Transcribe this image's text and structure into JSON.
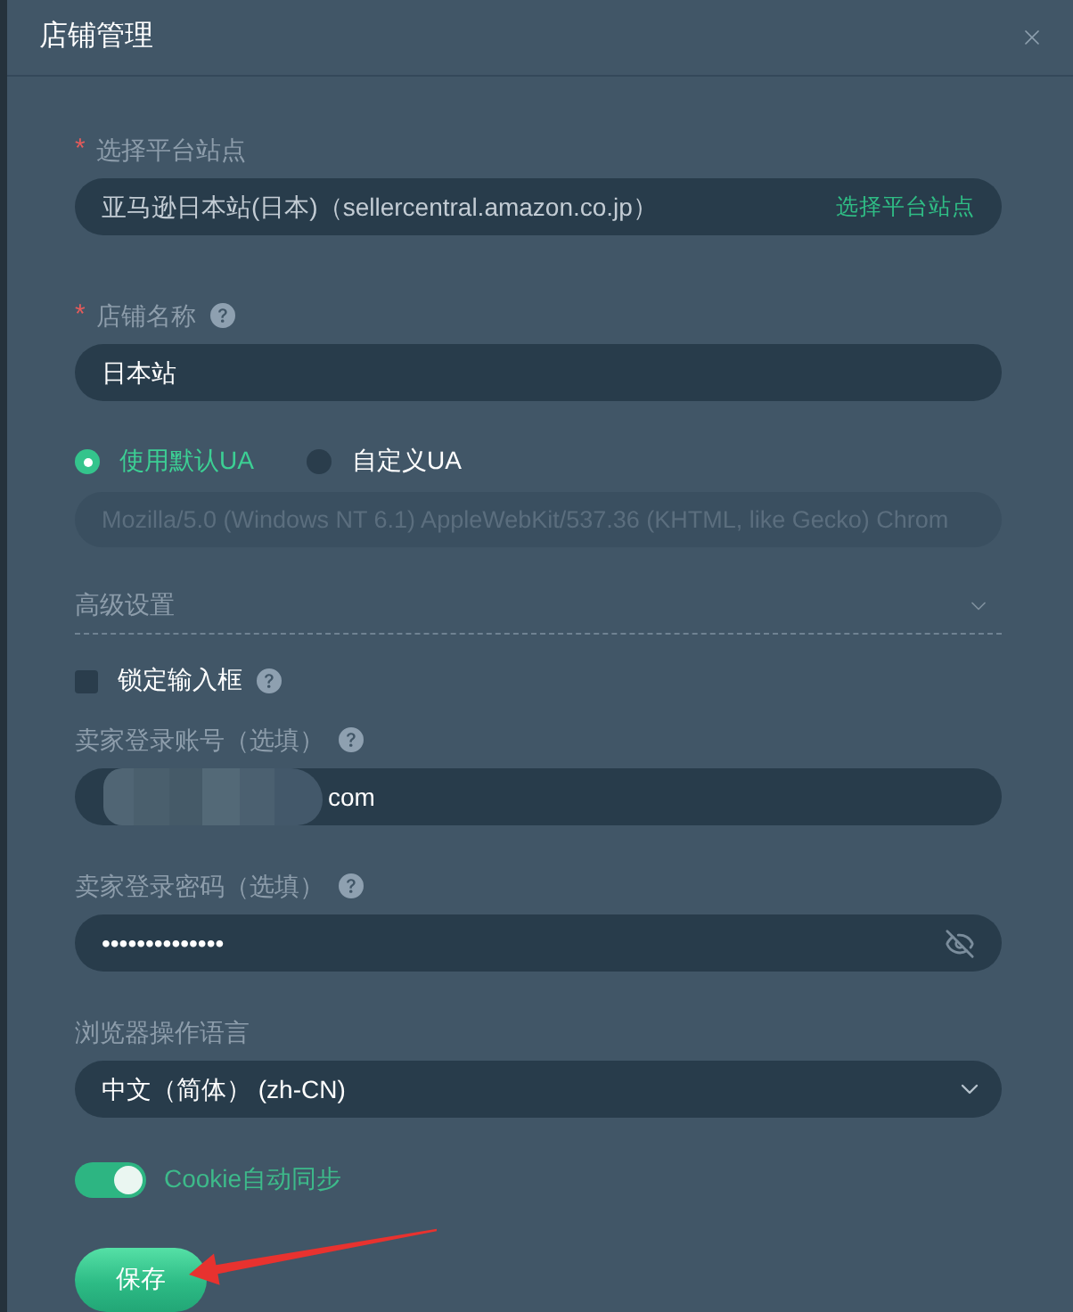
{
  "dialog": {
    "title": "店铺管理"
  },
  "platform_site": {
    "required_mark": "*",
    "label": "选择平台站点",
    "value": "亚马逊日本站(日本)（sellercentral.amazon.co.jp）",
    "action": "选择平台站点"
  },
  "store_name": {
    "required_mark": "*",
    "label": "店铺名称",
    "help": true,
    "value": "日本站"
  },
  "ua_mode": {
    "options": [
      {
        "label": "使用默认UA",
        "selected": true
      },
      {
        "label": "自定义UA",
        "selected": false
      }
    ]
  },
  "user_agent": {
    "value": "Mozilla/5.0 (Windows NT 6.1) AppleWebKit/537.36 (KHTML, like Gecko) Chrom",
    "disabled": true
  },
  "advanced_settings": {
    "label": "高级设置",
    "expanded": false
  },
  "lock_inputs": {
    "label": "锁定输入框",
    "checked": false,
    "help": true
  },
  "seller_account": {
    "label": "卖家登录账号（选填）",
    "help": true,
    "value": "com",
    "redacted": true
  },
  "seller_password": {
    "label": "卖家登录密码（选填）",
    "help": true,
    "value": "••••••••••••••",
    "visible": false
  },
  "browser_language": {
    "label": "浏览器操作语言",
    "value": "中文（简体） (zh-CN)"
  },
  "cookie_sync": {
    "label": "Cookie自动同步",
    "on": true
  },
  "save_button": {
    "label": "保存"
  }
}
